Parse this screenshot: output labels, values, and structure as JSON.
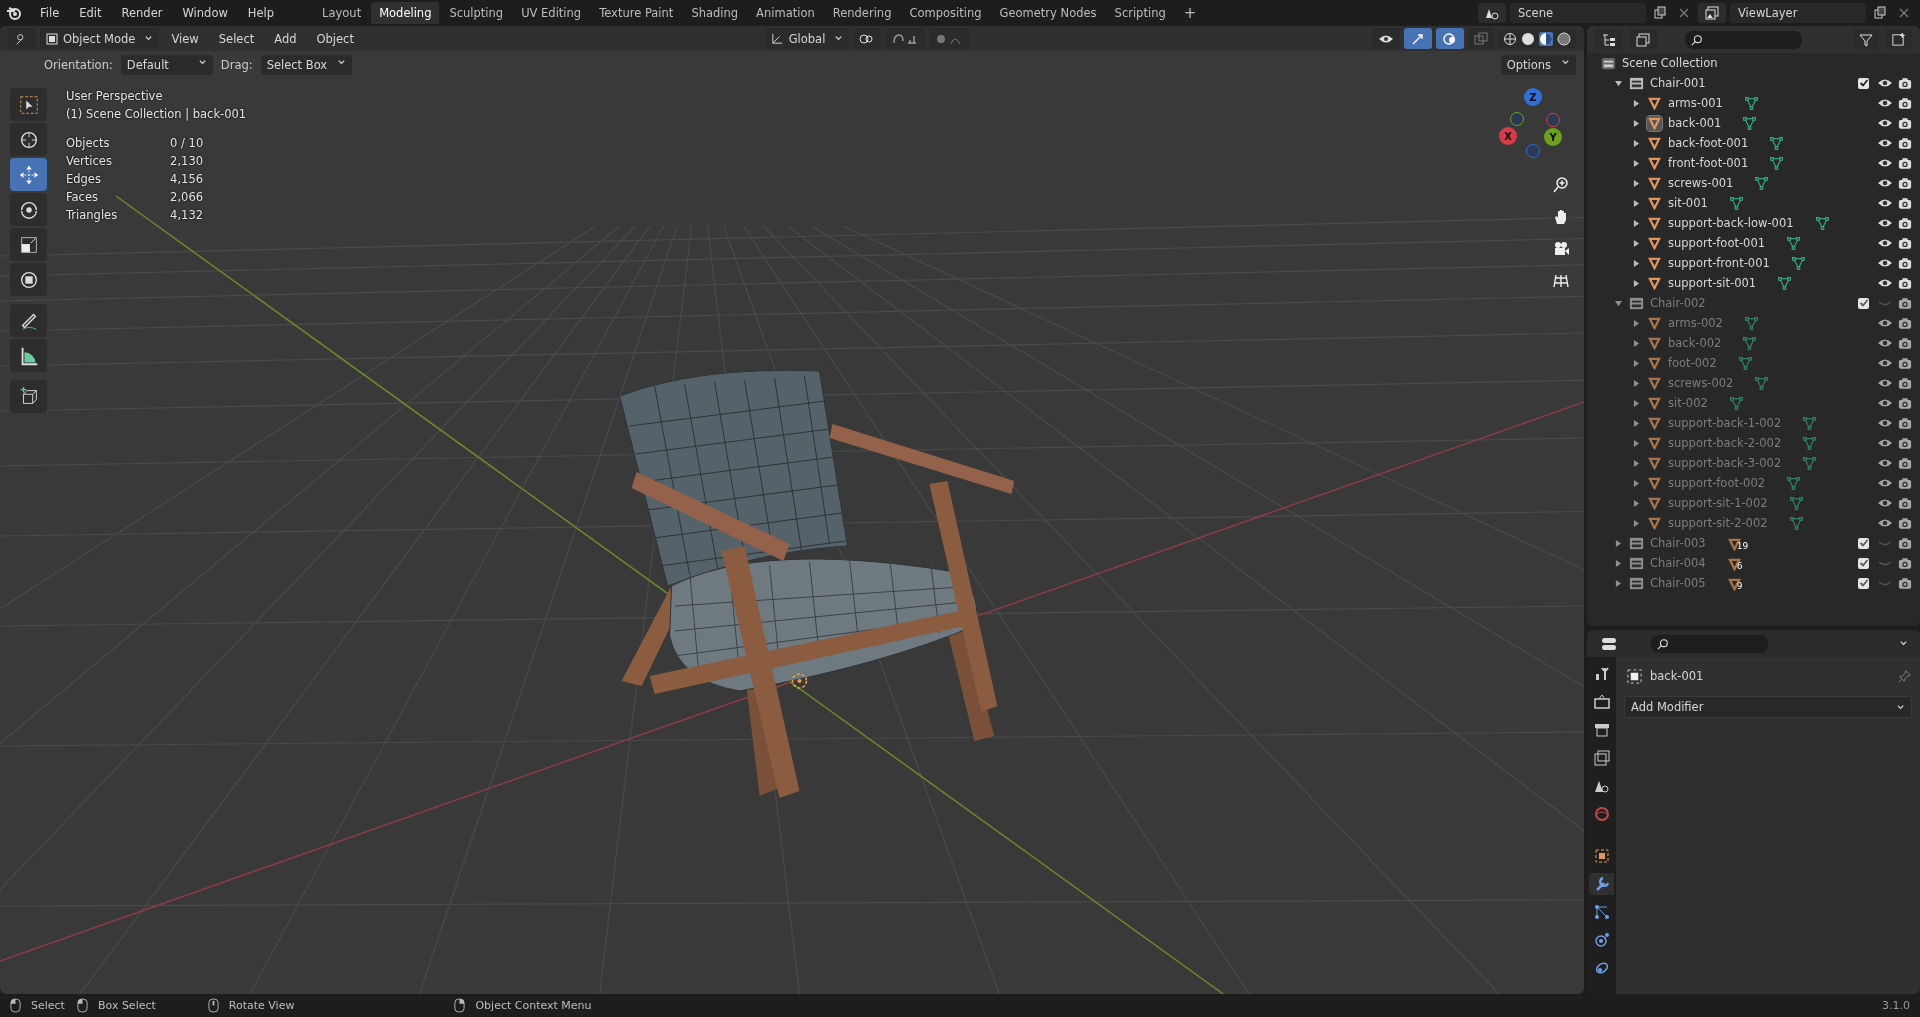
{
  "menu": [
    "File",
    "Edit",
    "Render",
    "Window",
    "Help"
  ],
  "workspaces": [
    {
      "label": "Layout",
      "selected": false
    },
    {
      "label": "Modeling",
      "selected": true
    },
    {
      "label": "Sculpting",
      "selected": false
    },
    {
      "label": "UV Editing",
      "selected": false
    },
    {
      "label": "Texture Paint",
      "selected": false
    },
    {
      "label": "Shading",
      "selected": false
    },
    {
      "label": "Animation",
      "selected": false
    },
    {
      "label": "Rendering",
      "selected": false
    },
    {
      "label": "Compositing",
      "selected": false
    },
    {
      "label": "Geometry Nodes",
      "selected": false
    },
    {
      "label": "Scripting",
      "selected": false
    }
  ],
  "add_workspace": "+",
  "scene": "Scene",
  "view_layer": "ViewLayer",
  "viewport_header": {
    "mode": "Object Mode",
    "menus": [
      "View",
      "Select",
      "Add",
      "Object"
    ],
    "transform": "Global"
  },
  "tool_settings": {
    "orientation_label": "Orientation:",
    "orientation": "Default",
    "drag_label": "Drag:",
    "drag": "Select Box",
    "options": "Options"
  },
  "tools": [
    {
      "kind": "select",
      "selected": false
    },
    {
      "kind": "cursor",
      "selected": false
    },
    {
      "kind": "move",
      "selected": true
    },
    {
      "kind": "rotate",
      "selected": false
    },
    {
      "kind": "scale",
      "selected": false
    },
    {
      "kind": "transform",
      "selected": false
    },
    {
      "kind": "annotate",
      "selected": false
    },
    {
      "kind": "measure",
      "selected": false
    },
    {
      "kind": "add-cube",
      "selected": false
    }
  ],
  "view_info": [
    "User Perspective",
    "(1) Scene Collection | back-001"
  ],
  "stats": [
    {
      "label": "Objects",
      "value": "0 / 10"
    },
    {
      "label": "Vertices",
      "value": "2,130"
    },
    {
      "label": "Edges",
      "value": "4,156"
    },
    {
      "label": "Faces",
      "value": "2,066"
    },
    {
      "label": "Triangles",
      "value": "4,132"
    }
  ],
  "gizmo": [
    {
      "label": "Z",
      "color": "#2f6fd6"
    },
    {
      "label": "Y",
      "color": "#6ca01e"
    },
    {
      "label": "X",
      "color": "#d63b4a"
    }
  ],
  "outliner": {
    "root": "Scene Collection",
    "collections": [
      {
        "name": "Chair-001",
        "expanded": true,
        "checked": true,
        "hidden": false,
        "children": [
          {
            "name": "arms-001",
            "selected": false
          },
          {
            "name": "back-001",
            "selected": true
          },
          {
            "name": "back-foot-001",
            "selected": false
          },
          {
            "name": "front-foot-001",
            "selected": false
          },
          {
            "name": "screws-001",
            "selected": false
          },
          {
            "name": "sit-001",
            "selected": false
          },
          {
            "name": "support-back-low-001",
            "selected": false
          },
          {
            "name": "support-foot-001",
            "selected": false
          },
          {
            "name": "support-front-001",
            "selected": false
          },
          {
            "name": "support-sit-001",
            "selected": false
          }
        ]
      },
      {
        "name": "Chair-002",
        "expanded": true,
        "checked": true,
        "hidden": true,
        "children": [
          {
            "name": "arms-002",
            "selected": false
          },
          {
            "name": "back-002",
            "selected": false
          },
          {
            "name": "foot-002",
            "selected": false
          },
          {
            "name": "screws-002",
            "selected": false
          },
          {
            "name": "sit-002",
            "selected": false
          },
          {
            "name": "support-back-1-002",
            "selected": false
          },
          {
            "name": "support-back-2-002",
            "selected": false
          },
          {
            "name": "support-back-3-002",
            "selected": false
          },
          {
            "name": "support-foot-002",
            "selected": false
          },
          {
            "name": "support-sit-1-002",
            "selected": false
          },
          {
            "name": "support-sit-2-002",
            "selected": false
          }
        ]
      },
      {
        "name": "Chair-003",
        "expanded": false,
        "checked": true,
        "hidden": true,
        "count": "19"
      },
      {
        "name": "Chair-004",
        "expanded": false,
        "checked": true,
        "hidden": true,
        "count": "6"
      },
      {
        "name": "Chair-005",
        "expanded": false,
        "checked": true,
        "hidden": true,
        "count": "9"
      }
    ]
  },
  "properties": {
    "object": "back-001",
    "add_modifier": "Add Modifier",
    "tabs": [
      {
        "kind": "tool",
        "selected": false
      },
      {
        "kind": "render",
        "selected": false
      },
      {
        "kind": "output",
        "selected": false
      },
      {
        "kind": "view-layer",
        "selected": false
      },
      {
        "kind": "scene",
        "selected": false
      },
      {
        "kind": "world",
        "selected": false
      },
      {
        "kind": "object",
        "selected": false
      },
      {
        "kind": "modifiers",
        "selected": true
      },
      {
        "kind": "particles",
        "selected": false
      },
      {
        "kind": "physics",
        "selected": false
      },
      {
        "kind": "constraints",
        "selected": false
      }
    ]
  },
  "status_bar": {
    "hints": [
      {
        "kind": "left",
        "text": "Select"
      },
      {
        "kind": "drag",
        "text": "Box Select"
      },
      {
        "kind": "middle",
        "text": "Rotate View"
      },
      {
        "kind": "right",
        "text": "Object Context Menu"
      }
    ],
    "version": "3.1.0"
  }
}
